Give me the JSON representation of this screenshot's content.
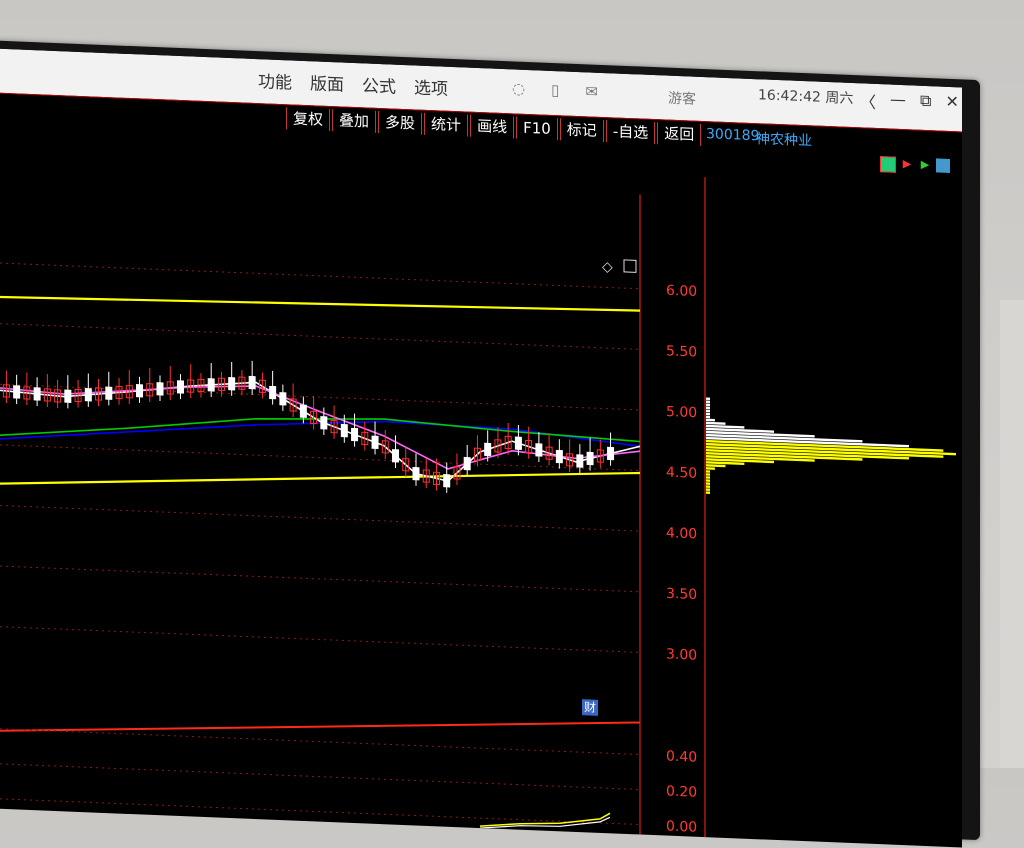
{
  "menu": {
    "items": [
      "功能",
      "版面",
      "公式",
      "选项"
    ],
    "guest_label": "游客"
  },
  "toolbar": {
    "buttons": [
      "复权",
      "叠加",
      "多股",
      "统计",
      "画线",
      "F10",
      "标记",
      "-自选",
      "返回"
    ]
  },
  "status": {
    "time": "16:42:42",
    "weekday": "周六"
  },
  "stock": {
    "code": "300189",
    "name": "神农种业"
  },
  "window_controls": {
    "back": "〈",
    "minimize": "—",
    "restore": "⧉",
    "close": "✕"
  },
  "chart_data": [
    {
      "type": "candlestick",
      "title": "",
      "y_ticks": [
        "6.00",
        "5.50",
        "5.00",
        "4.50",
        "4.00",
        "3.50",
        "3.00"
      ],
      "ylim": [
        2.9,
        6.2
      ],
      "series": [
        {
          "name": "",
          "color": "#ffff00",
          "kind": "trend-upper",
          "x": [
            0,
            100
          ],
          "values": [
            5.72,
            5.82
          ]
        },
        {
          "name": "",
          "color": "#ffff00",
          "kind": "trend-lower",
          "x": [
            0,
            100
          ],
          "values": [
            4.18,
            4.48
          ]
        },
        {
          "name": "",
          "color": "#0000ff",
          "kind": "ma-long",
          "x": [
            0,
            20,
            40,
            60,
            80,
            100
          ],
          "values": [
            4.55,
            4.65,
            4.75,
            4.82,
            4.8,
            4.7
          ]
        },
        {
          "name": "",
          "color": "#00cc00",
          "kind": "ma-long2",
          "x": [
            0,
            20,
            40,
            60,
            80,
            100
          ],
          "values": [
            4.58,
            4.68,
            4.8,
            4.84,
            4.78,
            4.74
          ]
        },
        {
          "name": "",
          "color": "#ffffff",
          "kind": "ma-short",
          "x": [
            0,
            10,
            20,
            30,
            40,
            50,
            60,
            65,
            70,
            75,
            80,
            90,
            100
          ],
          "values": [
            4.95,
            4.92,
            4.98,
            5.05,
            5.1,
            4.8,
            4.62,
            4.4,
            4.35,
            4.6,
            4.7,
            4.55,
            4.7
          ]
        },
        {
          "name": "",
          "color": "#ff66ff",
          "kind": "ma-mid",
          "x": [
            0,
            10,
            20,
            30,
            40,
            50,
            60,
            70,
            80,
            90,
            100
          ],
          "values": [
            4.97,
            4.94,
            4.99,
            5.04,
            5.07,
            4.88,
            4.7,
            4.45,
            4.62,
            4.58,
            4.66
          ]
        }
      ]
    },
    {
      "type": "line",
      "title": "",
      "y_ticks": [
        "0.40",
        "0.20",
        "0.00"
      ]
    }
  ],
  "volume_profile": {
    "peak_price": 4.75
  },
  "badges": {
    "cai": "财"
  }
}
